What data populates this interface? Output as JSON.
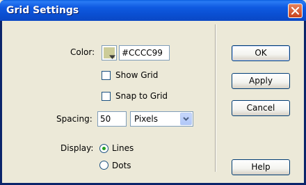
{
  "window": {
    "title": "Grid Settings"
  },
  "color": {
    "label": "Color:",
    "value": "#CCCC99",
    "swatch_color": "#CCCC99"
  },
  "show_grid": {
    "label": "Show Grid",
    "checked": false
  },
  "snap_to_grid": {
    "label": "Snap to Grid",
    "checked": false
  },
  "spacing": {
    "label": "Spacing:",
    "value": "50",
    "unit": "Pixels"
  },
  "display": {
    "label": "Display:",
    "options": [
      "Lines",
      "Dots"
    ],
    "selected": "Lines"
  },
  "buttons": {
    "ok": "OK",
    "apply": "Apply",
    "cancel": "Cancel",
    "help": "Help"
  },
  "theme": {
    "titlebar": "#0a4fd2",
    "face": "#ece9d8",
    "close": "#c9421c",
    "radio_dot": "#21a121"
  }
}
